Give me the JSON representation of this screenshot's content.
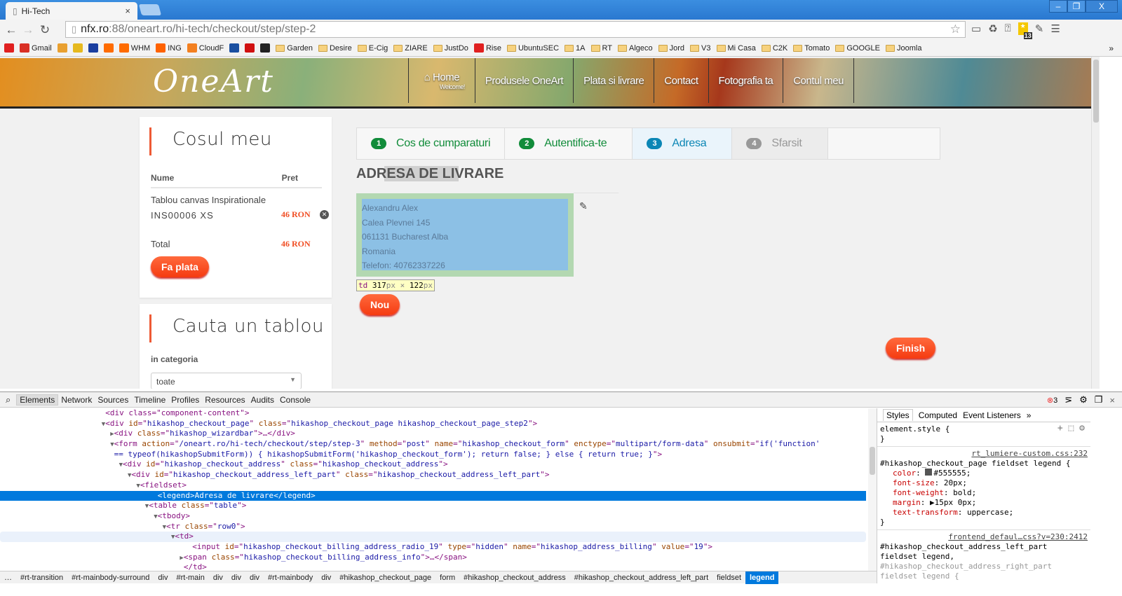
{
  "browser": {
    "tab_title": "Hi-Tech",
    "tab_close": "×",
    "url_host": "nfx.ro",
    "url_rest": ":88/oneart.ro/hi-tech/checkout/step/step-2",
    "extension_badge": "13",
    "bookmarks": [
      {
        "icon": "youtube-icon",
        "label": "",
        "color": "#e02020"
      },
      {
        "icon": "gmail-icon",
        "label": "Gmail",
        "color": "#d93025"
      },
      {
        "icon": "paint-icon",
        "label": "",
        "color": "#e9a030"
      },
      {
        "icon": "imdb-icon",
        "label": "",
        "color": "#e6b91e"
      },
      {
        "icon": "euro-icon",
        "label": "",
        "color": "#1b3fa0"
      },
      {
        "icon": "cpanel-icon",
        "label": "",
        "color": "#ff6c00"
      },
      {
        "icon": "cpanel-icon",
        "label": "WHM",
        "color": "#ff6c00"
      },
      {
        "icon": "ing-icon",
        "label": "ING",
        "color": "#ff6200"
      },
      {
        "icon": "cloudflare-icon",
        "label": "CloudF",
        "color": "#f38020"
      },
      {
        "icon": "twc-icon",
        "label": "",
        "color": "#1a4fa0"
      },
      {
        "icon": "opera-icon",
        "label": "",
        "color": "#d01010"
      },
      {
        "icon": "cf-icon",
        "label": "",
        "color": "#222222"
      },
      {
        "icon": "folder-icon",
        "label": "Garden"
      },
      {
        "icon": "folder-icon",
        "label": "Desire"
      },
      {
        "icon": "folder-icon",
        "label": "E-Cig"
      },
      {
        "icon": "folder-icon",
        "label": "ZIARE"
      },
      {
        "icon": "folder-icon",
        "label": "JustDo"
      },
      {
        "icon": "youtube-icon",
        "label": "Rise",
        "color": "#e02020"
      },
      {
        "icon": "folder-icon",
        "label": "UbuntuSEC"
      },
      {
        "icon": "folder-icon",
        "label": "1A"
      },
      {
        "icon": "folder-icon",
        "label": "RT"
      },
      {
        "icon": "folder-icon",
        "label": "Algeco"
      },
      {
        "icon": "folder-icon",
        "label": "Jord"
      },
      {
        "icon": "folder-icon",
        "label": "V3"
      },
      {
        "icon": "folder-icon",
        "label": "Mi Casa"
      },
      {
        "icon": "folder-icon",
        "label": "C2K"
      },
      {
        "icon": "folder-icon",
        "label": "Tomato"
      },
      {
        "icon": "folder-icon",
        "label": "GOOGLE"
      },
      {
        "icon": "folder-icon",
        "label": "Joomla"
      }
    ],
    "bookmarks_more": "»"
  },
  "site": {
    "logo": "OneArt",
    "nav": [
      {
        "label": "Home",
        "sub": "Welcome!"
      },
      {
        "label": "Produsele OneArt"
      },
      {
        "label": "Plata si livrare"
      },
      {
        "label": "Contact"
      },
      {
        "label": "Fotografia ta"
      },
      {
        "label": "Contul meu"
      }
    ],
    "cart": {
      "title": "Cosul meu",
      "col_name": "Nume",
      "col_price": "Pret",
      "item_name": "Tablou canvas Inspirationale",
      "item_code": "INS00006 XS",
      "item_price": "46 RON",
      "total_label": "Total",
      "total_price": "46 RON",
      "pay_button": "Fa plata"
    },
    "search": {
      "title": "Cauta un tablou",
      "category_label": "in categoria",
      "category_value": "toate"
    },
    "wizard": [
      {
        "num": "1",
        "label": "Cos de cumparaturi",
        "state": "done"
      },
      {
        "num": "2",
        "label": "Autentifica-te",
        "state": "done"
      },
      {
        "num": "3",
        "label": "Adresa",
        "state": "current"
      },
      {
        "num": "4",
        "label": "Sfarsit",
        "state": "todo"
      }
    ],
    "colors": {
      "done": "#118c3a",
      "current": "#0b86b5",
      "todo": "#999999",
      "accent": "#f04e24"
    },
    "legend": "ADRESA DE LIVRARE",
    "address": [
      "Alexandru Alex",
      "Calea Plevnei 145",
      "061131 Bucharest Alba",
      "Romania",
      "Telefon: 40762337226"
    ],
    "inspect_tip": {
      "tag": "td",
      "w": "317",
      "x": " × ",
      "h": "122",
      "unit": "px"
    },
    "new_button": "Nou",
    "finish_button": "Finish"
  },
  "devtools": {
    "tabs": [
      "Elements",
      "Network",
      "Sources",
      "Timeline",
      "Profiles",
      "Resources",
      "Audits",
      "Console"
    ],
    "error_count": "3",
    "dom_lines": [
      {
        "indent": 12,
        "arrow": "",
        "parts": [
          [
            "t",
            "<div class=\"component-content\">"
          ]
        ]
      },
      {
        "indent": 12,
        "arrow": "▼",
        "parts": [
          [
            "t",
            "<div "
          ],
          [
            "a",
            "id"
          ],
          [
            "t",
            "=\""
          ],
          [
            "v",
            "hikashop_checkout_page"
          ],
          [
            "t",
            "\" "
          ],
          [
            "a",
            "class"
          ],
          [
            "t",
            "=\""
          ],
          [
            "v",
            "hikashop_checkout_page hikashop_checkout_page_step2"
          ],
          [
            "t",
            "\">"
          ]
        ]
      },
      {
        "indent": 13,
        "arrow": "▶",
        "parts": [
          [
            "t",
            "<div "
          ],
          [
            "a",
            "class"
          ],
          [
            "t",
            "=\""
          ],
          [
            "v",
            "hikashop_wizardbar"
          ],
          [
            "t",
            "\">…</div>"
          ]
        ]
      },
      {
        "indent": 13,
        "arrow": "▼",
        "parts": [
          [
            "t",
            "<form "
          ],
          [
            "a",
            "action"
          ],
          [
            "t",
            "=\""
          ],
          [
            "v",
            "/oneart.ro/hi-tech/checkout/step/step-3"
          ],
          [
            "t",
            "\" "
          ],
          [
            "a",
            "method"
          ],
          [
            "t",
            "=\""
          ],
          [
            "v",
            "post"
          ],
          [
            "t",
            "\" "
          ],
          [
            "a",
            "name"
          ],
          [
            "t",
            "=\""
          ],
          [
            "v",
            "hikashop_checkout_form"
          ],
          [
            "t",
            "\" "
          ],
          [
            "a",
            "enctype"
          ],
          [
            "t",
            "=\""
          ],
          [
            "v",
            "multipart/form-data"
          ],
          [
            "t",
            "\" "
          ],
          [
            "a",
            "onsubmit"
          ],
          [
            "t",
            "=\""
          ],
          [
            "v",
            "if('function'"
          ]
        ]
      },
      {
        "indent": 13,
        "arrow": "",
        "parts": [
          [
            "v",
            "== typeof(hikashopSubmitForm)) { hikashopSubmitForm('hikashop_checkout_form'); return false; } else { return true; }"
          ],
          [
            "t",
            "\">"
          ]
        ]
      },
      {
        "indent": 14,
        "arrow": "▼",
        "parts": [
          [
            "t",
            "<div "
          ],
          [
            "a",
            "id"
          ],
          [
            "t",
            "=\""
          ],
          [
            "v",
            "hikashop_checkout_address"
          ],
          [
            "t",
            "\" "
          ],
          [
            "a",
            "class"
          ],
          [
            "t",
            "=\""
          ],
          [
            "v",
            "hikashop_checkout_address"
          ],
          [
            "t",
            "\">"
          ]
        ]
      },
      {
        "indent": 15,
        "arrow": "▼",
        "parts": [
          [
            "t",
            "<div "
          ],
          [
            "a",
            "id"
          ],
          [
            "t",
            "=\""
          ],
          [
            "v",
            "hikashop_checkout_address_left_part"
          ],
          [
            "t",
            "\" "
          ],
          [
            "a",
            "class"
          ],
          [
            "t",
            "=\""
          ],
          [
            "v",
            "hikashop_checkout_address_left_part"
          ],
          [
            "t",
            "\">"
          ]
        ]
      },
      {
        "indent": 16,
        "arrow": "▼",
        "parts": [
          [
            "t",
            "<fieldset>"
          ]
        ]
      },
      {
        "indent": 18,
        "arrow": "",
        "sel": true,
        "parts": [
          [
            "t",
            "<legend>"
          ],
          [
            "x",
            "Adresa de livrare"
          ],
          [
            "t",
            "</legend>"
          ]
        ]
      },
      {
        "indent": 17,
        "arrow": "▼",
        "parts": [
          [
            "t",
            "<table "
          ],
          [
            "a",
            "class"
          ],
          [
            "t",
            "=\""
          ],
          [
            "v",
            "table"
          ],
          [
            "t",
            "\">"
          ]
        ]
      },
      {
        "indent": 18,
        "arrow": "▼",
        "parts": [
          [
            "t",
            "<tbody>"
          ]
        ]
      },
      {
        "indent": 19,
        "arrow": "▼",
        "parts": [
          [
            "t",
            "<tr "
          ],
          [
            "a",
            "class"
          ],
          [
            "t",
            "=\""
          ],
          [
            "v",
            "row0"
          ],
          [
            "t",
            "\">"
          ]
        ]
      },
      {
        "indent": 20,
        "arrow": "▼",
        "hov": true,
        "parts": [
          [
            "t",
            "<td>"
          ]
        ]
      },
      {
        "indent": 22,
        "arrow": "",
        "parts": [
          [
            "t",
            "<input "
          ],
          [
            "a",
            "id"
          ],
          [
            "t",
            "=\""
          ],
          [
            "v",
            "hikashop_checkout_billing_address_radio_19"
          ],
          [
            "t",
            "\" "
          ],
          [
            "a",
            "type"
          ],
          [
            "t",
            "=\""
          ],
          [
            "v",
            "hidden"
          ],
          [
            "t",
            "\" "
          ],
          [
            "a",
            "name"
          ],
          [
            "t",
            "=\""
          ],
          [
            "v",
            "hikashop_address_billing"
          ],
          [
            "t",
            "\" "
          ],
          [
            "a",
            "value"
          ],
          [
            "t",
            "=\""
          ],
          [
            "v",
            "19"
          ],
          [
            "t",
            "\">"
          ]
        ]
      },
      {
        "indent": 21,
        "arrow": "▶",
        "parts": [
          [
            "t",
            "<span "
          ],
          [
            "a",
            "class"
          ],
          [
            "t",
            "=\""
          ],
          [
            "v",
            "hikashop_checkout_billing_address_info"
          ],
          [
            "t",
            "\">…</span>"
          ]
        ]
      },
      {
        "indent": 21,
        "arrow": "",
        "parts": [
          [
            "t",
            "</td>"
          ]
        ]
      }
    ],
    "breadcrumbs": [
      "…",
      "#rt-transition",
      "#rt-mainbody-surround",
      "div",
      "#rt-main",
      "div",
      "div",
      "div",
      "#rt-mainbody",
      "div",
      "#hikashop_checkout_page",
      "form",
      "#hikashop_checkout_address",
      "#hikashop_checkout_address_left_part",
      "fieldset",
      "legend"
    ],
    "style_tabs": [
      "Styles",
      "Computed",
      "Event Listeners",
      "»"
    ],
    "element_style": "element.style {",
    "close_brace": "}",
    "rule1": {
      "source": "rt_lumiere-custom.css:232",
      "selector": "#hikashop_checkout_page fieldset legend {",
      "props": [
        {
          "name": "color",
          "value": "#555555;"
        },
        {
          "name": "font-size",
          "value": "20px;"
        },
        {
          "name": "font-weight",
          "value": "bold;"
        },
        {
          "name": "margin",
          "value": "▶15px 0px;"
        },
        {
          "name": "text-transform",
          "value": "uppercase;"
        }
      ]
    },
    "rule2": {
      "source": "frontend_defaul…css?v=230:2412",
      "selector_lines": [
        "#hikashop_checkout_address_left_part",
        "fieldset legend,",
        "#hikashop_checkout_address_right_part",
        "fieldset legend {"
      ]
    }
  }
}
